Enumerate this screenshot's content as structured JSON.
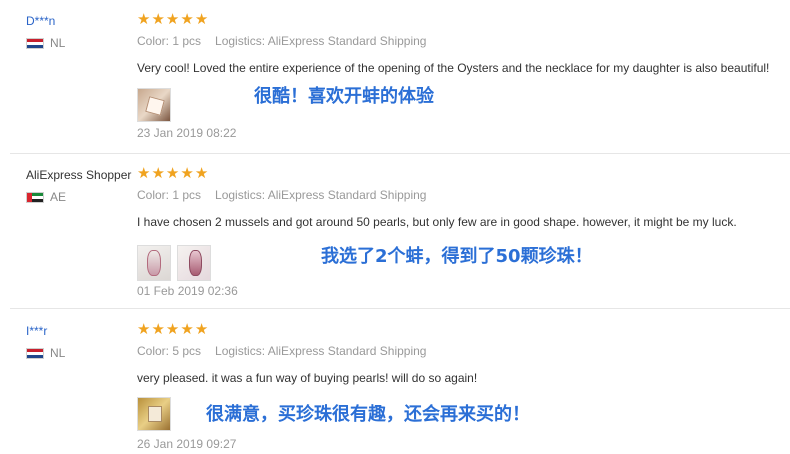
{
  "colors": {
    "star": "#f0a320",
    "caption": "#2b6fd6",
    "link": "#2a64c8"
  },
  "reviews": [
    {
      "user": "D***n",
      "country_code": "NL",
      "flag": "netherlands-flag",
      "rating": 5,
      "stars": [
        "★",
        "★",
        "★",
        "★",
        "★"
      ],
      "color_label": "Color: 1 pcs",
      "logistics_label": "Logistics: AliExpress Standard Shipping",
      "text": "Very cool! Loved the entire experience of the opening of the Oysters and the necklace for my daughter is also beautiful!",
      "caption": "很酷！喜欢开蚌的体验",
      "date": "23 Jan 2019 08:22"
    },
    {
      "user": "AliExpress Shopper",
      "country_code": "AE",
      "flag": "uae-flag",
      "rating": 5,
      "stars": [
        "★",
        "★",
        "★",
        "★",
        "★"
      ],
      "color_label": "Color: 1 pcs",
      "logistics_label": "Logistics: AliExpress Standard Shipping",
      "text": "I have chosen 2 mussels and got around 50 pearls, but only few are in good shape. however, it might be my luck.",
      "caption": "我选了2个蚌，得到了50颗珍珠！",
      "date": "01 Feb 2019 02:36"
    },
    {
      "user": "I***r",
      "country_code": "NL",
      "flag": "netherlands-flag",
      "rating": 5,
      "stars": [
        "★",
        "★",
        "★",
        "★",
        "★"
      ],
      "color_label": "Color: 5 pcs",
      "logistics_label": "Logistics: AliExpress Standard Shipping",
      "text": "very pleased. it was a fun way of buying pearls! will do so again!",
      "caption": "很满意，买珍珠很有趣，还会再来买的！",
      "date": "26 Jan 2019 09:27"
    }
  ]
}
